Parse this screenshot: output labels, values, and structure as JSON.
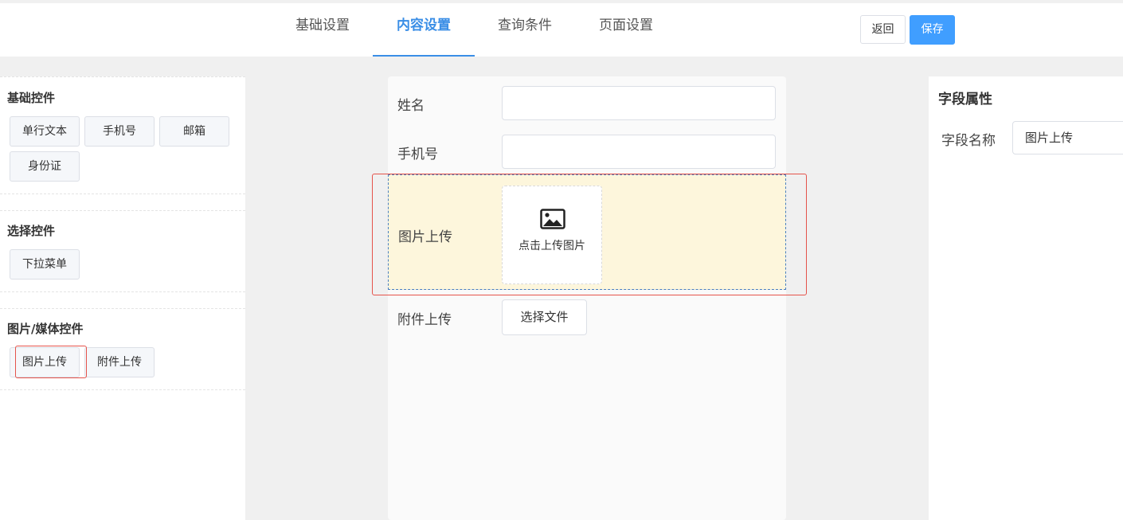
{
  "header": {
    "tabs": [
      {
        "label": "基础设置"
      },
      {
        "label": "内容设置"
      },
      {
        "label": "查询条件"
      },
      {
        "label": "页面设置"
      }
    ],
    "active_tab": "内容设置",
    "back_label": "返回",
    "save_label": "保存"
  },
  "palette": {
    "basic": {
      "title": "基础控件",
      "items": [
        "单行文本",
        "手机号",
        "邮箱",
        "身份证"
      ]
    },
    "select": {
      "title": "选择控件",
      "items": [
        "下拉菜单"
      ]
    },
    "media": {
      "title": "图片/媒体控件",
      "items": [
        "图片上传",
        "附件上传"
      ]
    }
  },
  "form": {
    "fields": [
      {
        "label": "姓名",
        "value": ""
      },
      {
        "label": "手机号",
        "value": ""
      },
      {
        "label": "图片上传",
        "upload_text": "点击上传图片"
      },
      {
        "label": "附件上传",
        "button_label": "选择文件"
      }
    ]
  },
  "properties": {
    "title": "字段属性",
    "field_name_label": "字段名称",
    "field_name_value": "图片上传"
  },
  "colors": {
    "accent": "#409eff",
    "selected_row_bg": "#fdf6dc",
    "highlight_border": "#e5534b"
  }
}
